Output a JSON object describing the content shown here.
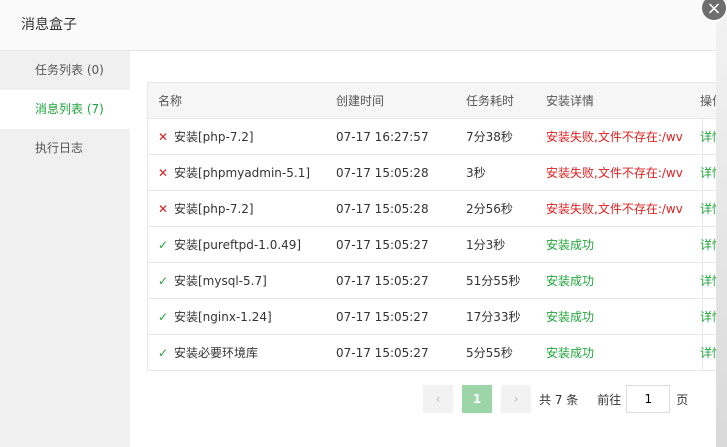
{
  "dialog": {
    "title": "消息盒子",
    "close_icon": "×"
  },
  "sidebar": {
    "items": [
      {
        "label": "任务列表 (0)"
      },
      {
        "label": "消息列表 (7)",
        "active": true
      },
      {
        "label": "执行日志"
      }
    ]
  },
  "table": {
    "headers": [
      "名称",
      "创建时间",
      "任务耗时",
      "安装详情",
      "操作"
    ],
    "rows": [
      {
        "status": "fail",
        "icon": "✕",
        "name": "安装[php-7.2]",
        "time": "07-17 16:27:57",
        "duration": "7分38秒",
        "detail": "安装失败,文件不存在:/wv",
        "op": "详情"
      },
      {
        "status": "fail",
        "icon": "✕",
        "name": "安装[phpmyadmin-5.1]",
        "time": "07-17 15:05:28",
        "duration": "3秒",
        "detail": "安装失败,文件不存在:/wv",
        "op": "详情"
      },
      {
        "status": "fail",
        "icon": "✕",
        "name": "安装[php-7.2]",
        "time": "07-17 15:05:28",
        "duration": "2分56秒",
        "detail": "安装失败,文件不存在:/wv",
        "op": "详情"
      },
      {
        "status": "ok",
        "icon": "✓",
        "name": "安装[pureftpd-1.0.49]",
        "time": "07-17 15:05:27",
        "duration": "1分3秒",
        "detail": "安装成功",
        "op": "详情"
      },
      {
        "status": "ok",
        "icon": "✓",
        "name": "安装[mysql-5.7]",
        "time": "07-17 15:05:27",
        "duration": "51分55秒",
        "detail": "安装成功",
        "op": "详情"
      },
      {
        "status": "ok",
        "icon": "✓",
        "name": "安装[nginx-1.24]",
        "time": "07-17 15:05:27",
        "duration": "17分33秒",
        "detail": "安装成功",
        "op": "详情"
      },
      {
        "status": "ok",
        "icon": "✓",
        "name": "安装必要环境库",
        "time": "07-17 15:05:27",
        "duration": "5分55秒",
        "detail": "安装成功",
        "op": "详情"
      }
    ]
  },
  "pagination": {
    "prev_icon": "‹",
    "current_page": "1",
    "next_icon": "›",
    "total": "共 7 条",
    "goto_label": "前往",
    "goto_value": "1",
    "page_unit": "页"
  },
  "colors": {
    "accent": "#20a53a",
    "error": "#e02020"
  }
}
